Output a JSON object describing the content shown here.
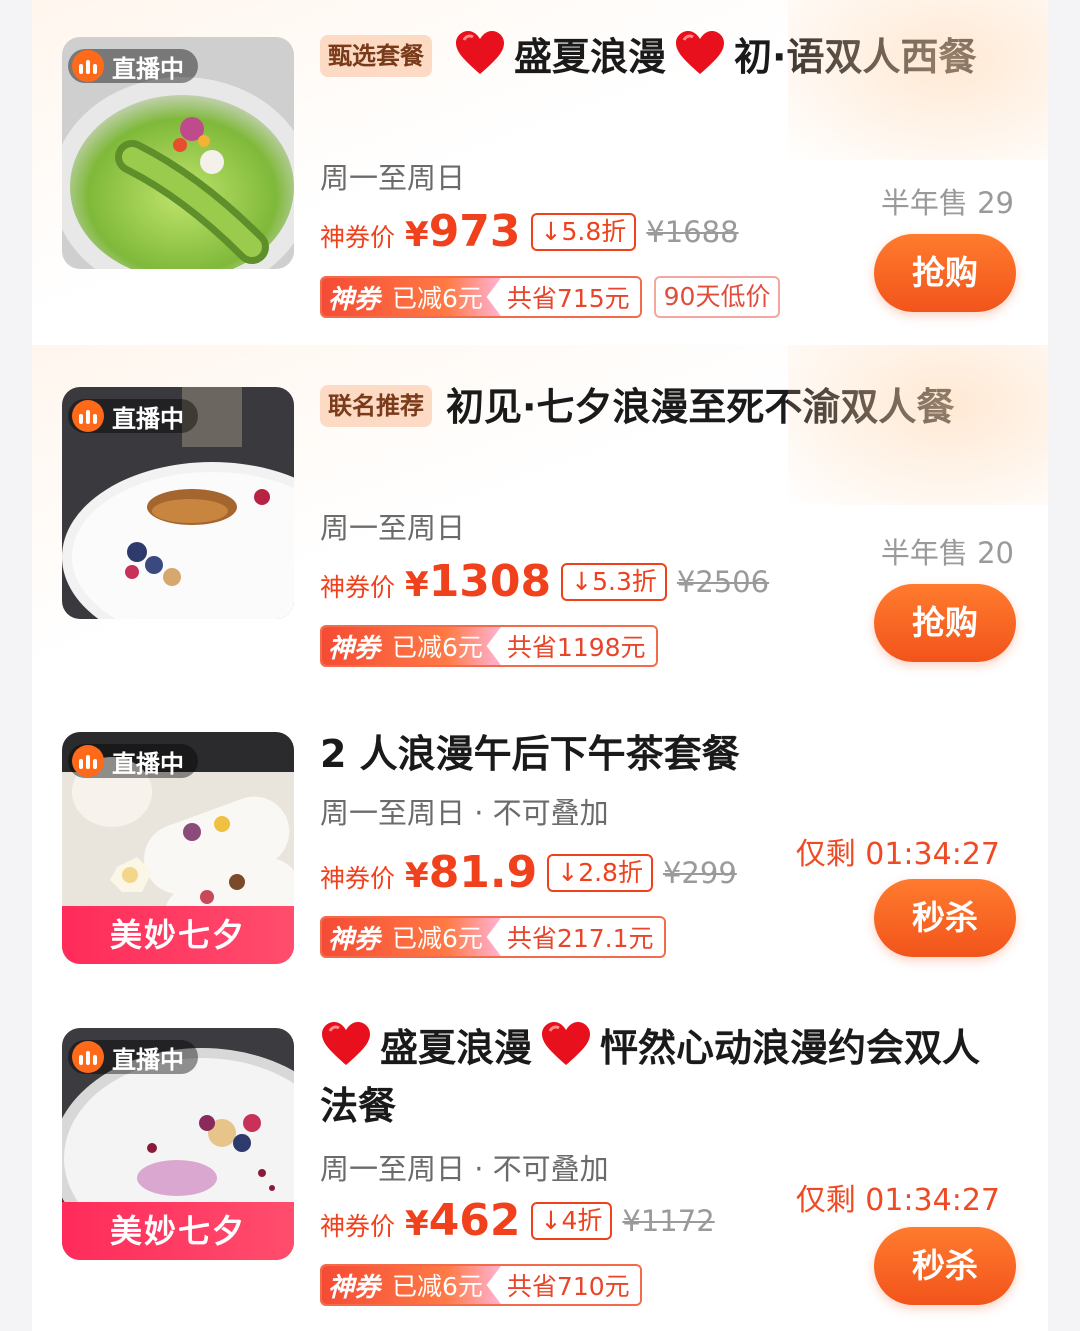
{
  "items": [
    {
      "live_label": "直播中",
      "tag": "甄选套餐",
      "title_parts": [
        "盛夏浪漫",
        "初·语双人西餐"
      ],
      "subtitle": "周一至周日",
      "price_label": "神券价",
      "currency": "¥",
      "price": "973",
      "discount": "5.8折",
      "original_price": "¥1688",
      "coupon_badge": "神券",
      "coupon_reduced": "已减6元",
      "coupon_saved": "共省715元",
      "low_price_badge": "90天低价",
      "sales": "半年售 29",
      "button": "抢购"
    },
    {
      "live_label": "直播中",
      "tag": "联名推荐",
      "title": "初见·七夕浪漫至死不渝双人餐",
      "subtitle": "周一至周日",
      "price_label": "神券价",
      "currency": "¥",
      "price": "1308",
      "discount": "5.3折",
      "original_price": "¥2506",
      "coupon_badge": "神券",
      "coupon_reduced": "已减6元",
      "coupon_saved": "共省1198元",
      "sales": "半年售 20",
      "button": "抢购"
    },
    {
      "live_label": "直播中",
      "event_banner": "美妙七夕",
      "title": "2 人浪漫午后下午茶套餐",
      "subtitle": "周一至周日 · 不可叠加",
      "price_label": "神券价",
      "currency": "¥",
      "price": "81.9",
      "discount": "2.8折",
      "original_price": "¥299",
      "coupon_badge": "神券",
      "coupon_reduced": "已减6元",
      "coupon_saved": "共省217.1元",
      "countdown": "仅剩 01:34:27",
      "button": "秒杀"
    },
    {
      "live_label": "直播中",
      "event_banner": "美妙七夕",
      "title_parts": [
        "盛夏浪漫",
        "怦然心动浪漫约会双人法餐"
      ],
      "subtitle": "周一至周日 · 不可叠加",
      "price_label": "神券价",
      "currency": "¥",
      "price": "462",
      "discount": "4折",
      "original_price": "¥1172",
      "coupon_badge": "神券",
      "coupon_reduced": "已减6元",
      "coupon_saved": "共省710元",
      "countdown": "仅剩 01:34:27",
      "button": "秒杀"
    }
  ],
  "icons": {
    "live": "live-bars-icon",
    "heart": "red-heart-icon",
    "discount_arrow": "down-arrow-icon"
  },
  "colors": {
    "accent": "#f0401c",
    "button": "#f2541b",
    "tag_bg": "#fcdac4",
    "event_banner": "#ff2b5a"
  }
}
